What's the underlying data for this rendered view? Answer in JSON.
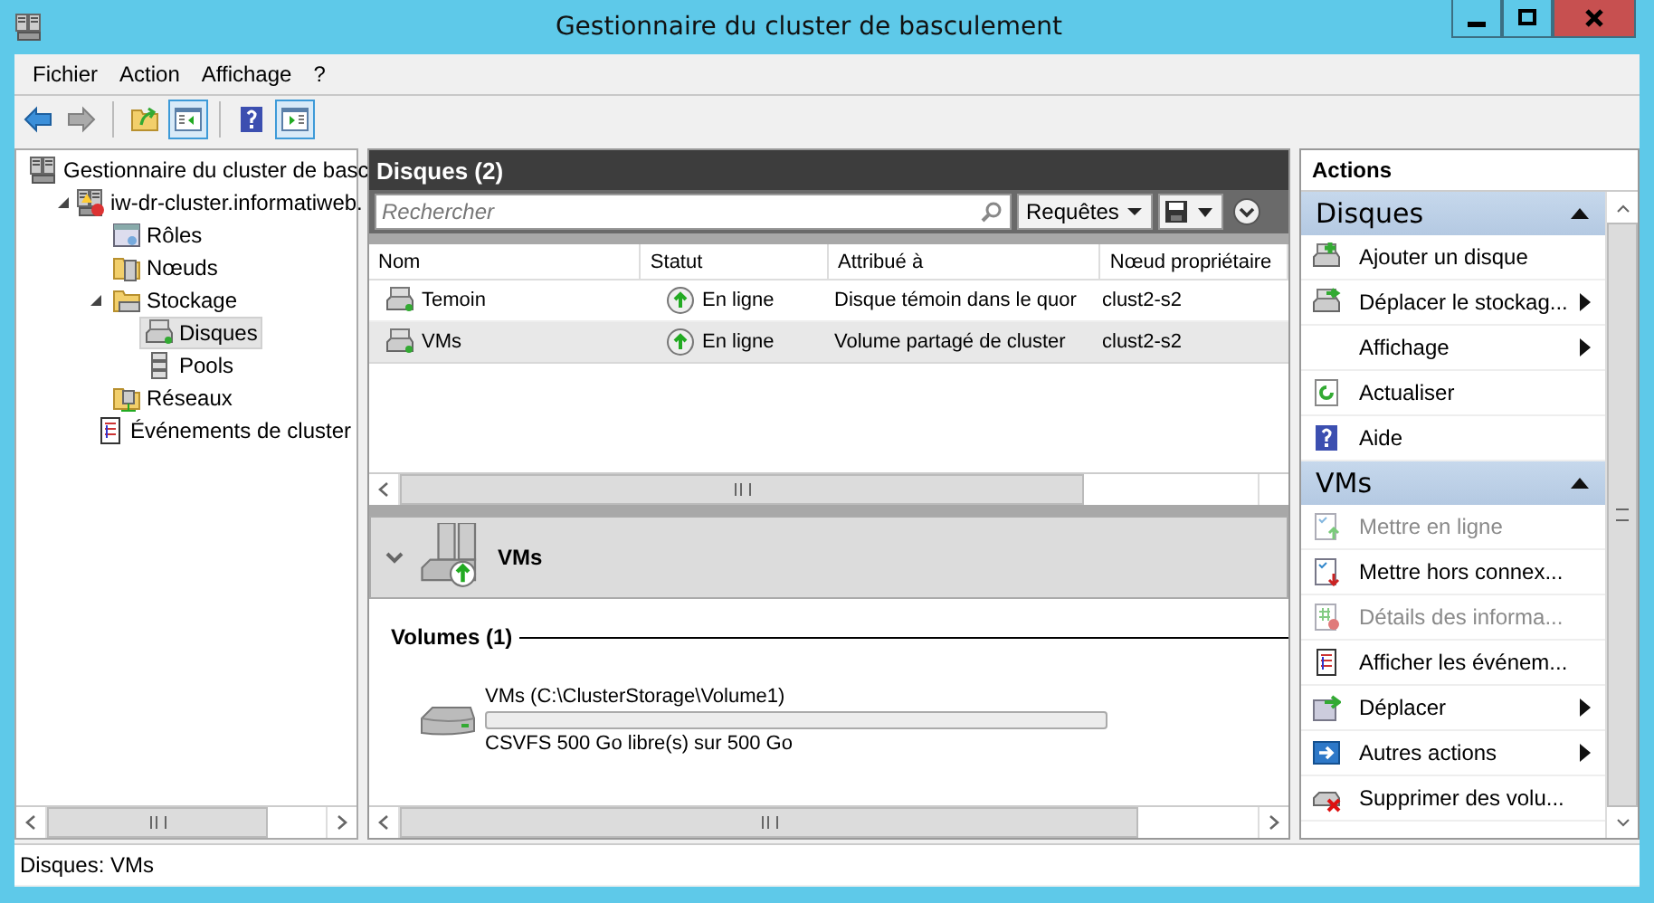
{
  "window": {
    "title": "Gestionnaire du cluster de basculement"
  },
  "menu": [
    "Fichier",
    "Action",
    "Affichage",
    "?"
  ],
  "toolbar": [
    {
      "kind": "back",
      "pressed": false,
      "disabled": false
    },
    {
      "kind": "forward",
      "pressed": false,
      "disabled": true
    },
    {
      "kind": "up",
      "pressed": false,
      "disabled": false
    },
    {
      "kind": "tree",
      "pressed": true,
      "disabled": false
    },
    {
      "kind": "help",
      "pressed": false,
      "disabled": false
    },
    {
      "kind": "actions",
      "pressed": true,
      "disabled": false
    }
  ],
  "tree": [
    {
      "label": "Gestionnaire du cluster de basc",
      "kind": "manager",
      "selected": false,
      "children": [
        {
          "label": "iw-dr-cluster.informatiweb.",
          "kind": "cluster",
          "selected": false,
          "expanded": true,
          "children": [
            {
              "label": "Rôles",
              "kind": "roles",
              "selected": false
            },
            {
              "label": "Nœuds",
              "kind": "nodes",
              "selected": false
            },
            {
              "label": "Stockage",
              "kind": "storage",
              "selected": false,
              "expanded": true,
              "children": [
                {
                  "label": "Disques",
                  "kind": "disks",
                  "selected": true
                },
                {
                  "label": "Pools",
                  "kind": "pools",
                  "selected": false
                }
              ]
            },
            {
              "label": "Réseaux",
              "kind": "networks",
              "selected": false
            },
            {
              "label": "Événements de cluster",
              "kind": "events",
              "selected": false
            }
          ]
        }
      ]
    }
  ],
  "center": {
    "title": "Disques (2)",
    "search": {
      "placeholder": "Rechercher"
    },
    "query_button": "Requêtes",
    "table": {
      "columns": [
        "Nom",
        "Statut",
        "Attribué à",
        "Nœud propriétaire"
      ],
      "rows": [
        {
          "selected": false,
          "cells": [
            "Temoin",
            "En ligne",
            "Disque témoin dans le quor",
            "clust2-s2"
          ]
        },
        {
          "selected": true,
          "cells": [
            "VMs",
            "En ligne",
            "Volume partagé de cluster",
            "clust2-s2"
          ]
        }
      ]
    },
    "details": {
      "title": "VMs",
      "section": "Volumes (1)",
      "volume": {
        "name": "VMs (C:\\ClusterStorage\\Volume1)",
        "level": 0,
        "info": "CSVFS 500 Go libre(s) sur 500 Go"
      }
    }
  },
  "actions": {
    "title": "Actions",
    "sections": [
      {
        "title": "Disques",
        "items": [
          {
            "label": "Ajouter un disque",
            "kind": "add",
            "disabled": false,
            "submenu": false
          },
          {
            "label": "Déplacer le stockag...",
            "kind": "move",
            "disabled": false,
            "submenu": true
          },
          {
            "label": "Affichage",
            "kind": "none",
            "disabled": false,
            "submenu": true
          },
          {
            "label": "Actualiser",
            "kind": "refresh",
            "disabled": false,
            "submenu": false
          },
          {
            "label": "Aide",
            "kind": "help",
            "disabled": false,
            "submenu": false
          }
        ]
      },
      {
        "title": "VMs",
        "items": [
          {
            "label": "Mettre en ligne",
            "kind": "online",
            "disabled": true,
            "submenu": false
          },
          {
            "label": "Mettre hors connex...",
            "kind": "offline",
            "disabled": false,
            "submenu": false
          },
          {
            "label": "Détails des informa...",
            "kind": "details",
            "disabled": true,
            "submenu": false
          },
          {
            "label": "Afficher les événem...",
            "kind": "events",
            "disabled": false,
            "submenu": false
          },
          {
            "label": "Déplacer",
            "kind": "movevm",
            "disabled": false,
            "submenu": true
          },
          {
            "label": "Autres actions",
            "kind": "more",
            "disabled": false,
            "submenu": true
          },
          {
            "label": "Supprimer des volu...",
            "kind": "remove",
            "disabled": false,
            "submenu": false
          }
        ]
      }
    ]
  },
  "status_bar": "Disques:  VMs"
}
